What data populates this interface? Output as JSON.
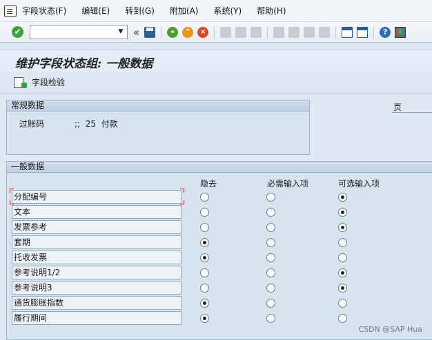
{
  "menu": {
    "items": [
      "字段状态(F)",
      "编辑(E)",
      "转到(G)",
      "附加(A)",
      "系统(Y)",
      "帮助(H)"
    ]
  },
  "toolbar": {
    "command_value": "",
    "chevron": "«"
  },
  "title": "维护字段状态组: 一般数据",
  "app_toolbar": {
    "field_check_label": "字段检验"
  },
  "general_data_group": {
    "header": "常规数据",
    "posting_key_label": "过账码",
    "posting_key_value": ";;  25  付款",
    "page_label": "页"
  },
  "fields_group": {
    "header": "一般数据",
    "columns": [
      "隐去",
      "必需输入项",
      "可选输入项"
    ],
    "rows": [
      {
        "label": "分配编号",
        "selected": "optional"
      },
      {
        "label": "文本",
        "selected": "optional"
      },
      {
        "label": "发票参考",
        "selected": "optional"
      },
      {
        "label": "套期",
        "selected": "suppress"
      },
      {
        "label": "托收发票",
        "selected": "suppress"
      },
      {
        "label": "参考说明1/2",
        "selected": "optional"
      },
      {
        "label": "参考说明3",
        "selected": "optional"
      },
      {
        "label": "通货膨胀指数",
        "selected": "suppress"
      },
      {
        "label": "履行期间",
        "selected": "suppress"
      }
    ]
  },
  "watermark": "CSDN @SAP Hua",
  "icons": {
    "toolbar": [
      "ok-icon",
      "save-icon",
      "back-icon",
      "exit-icon",
      "cancel-icon",
      "print-icon",
      "find-icon",
      "find-next-icon",
      "first-page-icon",
      "prev-page-icon",
      "next-page-icon",
      "last-page-icon",
      "new-session-icon",
      "shortcut-icon",
      "help-icon",
      "customize-layout-icon"
    ]
  }
}
